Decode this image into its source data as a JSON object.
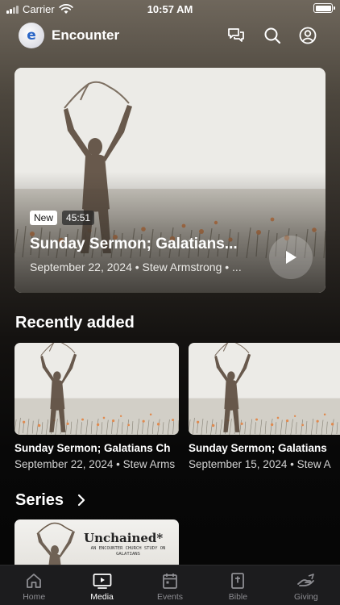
{
  "status": {
    "carrier": "Carrier",
    "time": "10:57 AM"
  },
  "header": {
    "logo_letter": "e",
    "title": "Encounter"
  },
  "hero": {
    "badge": "New",
    "duration": "45:51",
    "title": "Sunday Sermon; Galatians...",
    "meta": "September 22, 2024 • Stew Armstrong • ..."
  },
  "recent": {
    "title": "Recently added",
    "items": [
      {
        "title": "Sunday Sermon; Galatians Ch",
        "meta": "September 22, 2024 • Stew Arms"
      },
      {
        "title": "Sunday Sermon; Galatians",
        "meta": "September 15, 2024 • Stew A"
      }
    ]
  },
  "series": {
    "title": "Series",
    "card": {
      "title": "Unchained*",
      "subtitle": "AN ENCOUNTER CHURCH STUDY ON GALATIANS"
    }
  },
  "tabs": [
    {
      "label": "Home",
      "icon": "home-icon"
    },
    {
      "label": "Media",
      "icon": "media-icon"
    },
    {
      "label": "Events",
      "icon": "calendar-icon"
    },
    {
      "label": "Bible",
      "icon": "bible-icon"
    },
    {
      "label": "Giving",
      "icon": "giving-icon"
    }
  ],
  "active_tab": "Media",
  "colors": {
    "background": "#080808",
    "tab_bar": "#1c1c1e",
    "inactive_tab": "#8e8e93",
    "logo_letter": "#2a66c6"
  }
}
